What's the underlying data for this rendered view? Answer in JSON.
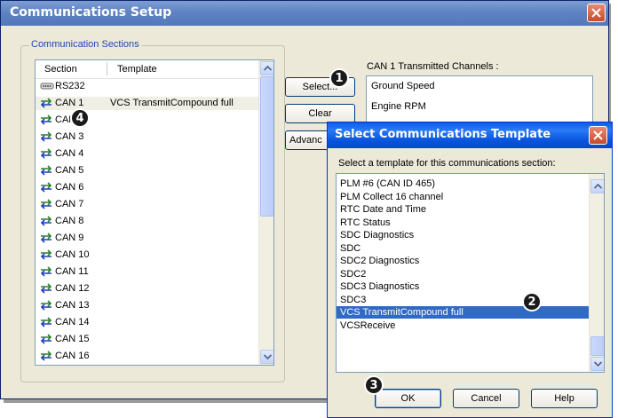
{
  "window": {
    "title": "Communications Setup"
  },
  "sections": {
    "group_label": "Communication Sections",
    "columns": [
      "Section",
      "Template"
    ],
    "rows": [
      {
        "section": "RS232",
        "template": "",
        "icon": "serial-port-icon"
      },
      {
        "section": "CAN 1",
        "template": "VCS TransmitCompound full",
        "icon": "bidirectional-arrows-icon",
        "selected": true
      },
      {
        "section": "CAN 2",
        "template": "",
        "icon": "bidirectional-arrows-icon"
      },
      {
        "section": "CAN 3",
        "template": "",
        "icon": "bidirectional-arrows-icon"
      },
      {
        "section": "CAN 4",
        "template": "",
        "icon": "bidirectional-arrows-icon"
      },
      {
        "section": "CAN 5",
        "template": "",
        "icon": "bidirectional-arrows-icon"
      },
      {
        "section": "CAN 6",
        "template": "",
        "icon": "bidirectional-arrows-icon"
      },
      {
        "section": "CAN 7",
        "template": "",
        "icon": "bidirectional-arrows-icon"
      },
      {
        "section": "CAN 8",
        "template": "",
        "icon": "bidirectional-arrows-icon"
      },
      {
        "section": "CAN 9",
        "template": "",
        "icon": "bidirectional-arrows-icon"
      },
      {
        "section": "CAN 10",
        "template": "",
        "icon": "bidirectional-arrows-icon"
      },
      {
        "section": "CAN 11",
        "template": "",
        "icon": "bidirectional-arrows-icon"
      },
      {
        "section": "CAN 12",
        "template": "",
        "icon": "bidirectional-arrows-icon"
      },
      {
        "section": "CAN 13",
        "template": "",
        "icon": "bidirectional-arrows-icon"
      },
      {
        "section": "CAN 14",
        "template": "",
        "icon": "bidirectional-arrows-icon"
      },
      {
        "section": "CAN 15",
        "template": "",
        "icon": "bidirectional-arrows-icon"
      },
      {
        "section": "CAN 16",
        "template": "",
        "icon": "bidirectional-arrows-icon"
      }
    ]
  },
  "buttons": {
    "select": "Select...",
    "clear": "Clear",
    "advanced": "Advanc"
  },
  "channels": {
    "label": "CAN 1 Transmitted Channels :",
    "items": [
      "Ground Speed",
      "Engine RPM"
    ]
  },
  "dialog": {
    "title": "Select Communications Template",
    "prompt": "Select a template for this communications section:",
    "templates": [
      "PLM #6 (CAN ID 465)",
      "PLM Collect 16 channel",
      "RTC Date and Time",
      "RTC Status",
      "SDC Diagnostics",
      "SDC",
      "SDC2 Diagnostics",
      "SDC2",
      "SDC3 Diagnostics",
      "SDC3",
      "VCS TransmitCompound full",
      "VCSReceive"
    ],
    "selected_template": "VCS TransmitCompound full",
    "ok": "OK",
    "cancel": "Cancel",
    "help": "Help"
  },
  "callouts": [
    "1",
    "2",
    "3",
    "4"
  ],
  "colors": {
    "title_bar": "#5f82c3",
    "dialog_title": "#0a5ee8",
    "selection": "#316ac5",
    "close_button": "#c84a2b",
    "group_label": "#1f49b6"
  }
}
